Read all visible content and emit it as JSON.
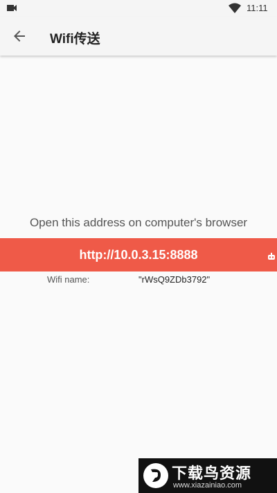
{
  "status_bar": {
    "time": "11:11",
    "icons": [
      "camera-icon",
      "wifi-signal-icon"
    ]
  },
  "app_bar": {
    "title": "Wifi传送",
    "back_icon": "arrow-back-icon"
  },
  "main": {
    "instruction": "Open this address on computer's browser",
    "address": "http://10.0.3.15:8888",
    "wifi_label": "Wifi name:",
    "wifi_value": "\"rWsQ9ZDb3792\""
  },
  "watermark": {
    "brand": "下载鸟资源",
    "domain": "www.xiazainiao.com"
  },
  "colors": {
    "banner": "#ef5a48",
    "background": "#fafafa",
    "app_bar": "#f5f5f5"
  }
}
